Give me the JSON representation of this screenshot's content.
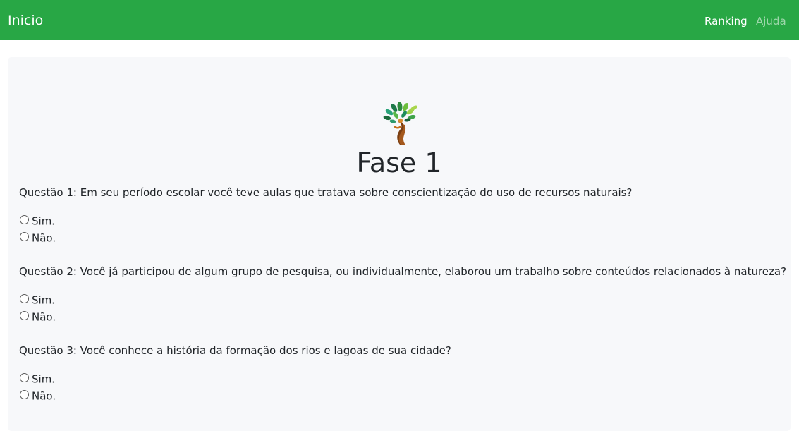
{
  "navbar": {
    "brand": "Inicio",
    "links": [
      {
        "label": "Ranking"
      },
      {
        "label": "Ajuda"
      }
    ],
    "color": "#28a745"
  },
  "main": {
    "logo_icon": "tree-logo-icon",
    "phase_title": "Fase 1",
    "questions": [
      {
        "text": "Questão 1: Em seu período escolar você teve aulas que tratava sobre conscientização do uso de recursos naturais?",
        "options": [
          "Sim.",
          "Não."
        ]
      },
      {
        "text": "Questão 2: Você já participou de algum grupo de pesquisa, ou individualmente, elaborou um trabalho sobre conteúdos relacionados à natureza?",
        "options": [
          "Sim.",
          "Não."
        ]
      },
      {
        "text": "Questão 3: Você conhece a história da formação dos rios e lagoas de sua cidade?",
        "options": [
          "Sim.",
          "Não."
        ]
      }
    ]
  }
}
